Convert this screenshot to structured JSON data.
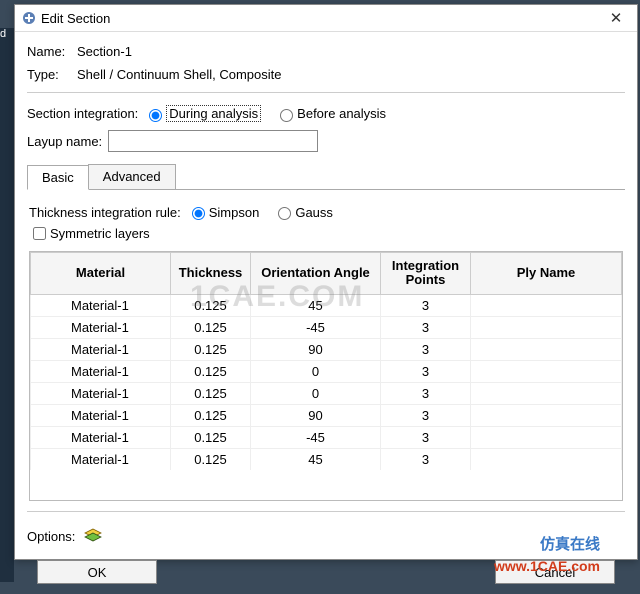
{
  "window": {
    "title": "Edit Section",
    "close": "✕"
  },
  "header": {
    "name_label": "Name:",
    "name_value": "Section-1",
    "type_label": "Type:",
    "type_value": "Shell / Continuum Shell, Composite"
  },
  "integration": {
    "label": "Section integration:",
    "during": "During analysis",
    "before": "Before analysis"
  },
  "layup": {
    "label": "Layup name:",
    "value": ""
  },
  "tabs": {
    "basic": "Basic",
    "advanced": "Advanced"
  },
  "thickness_rule": {
    "label": "Thickness integration rule:",
    "simpson": "Simpson",
    "gauss": "Gauss"
  },
  "symmetric_label": "Symmetric layers",
  "table": {
    "headers": {
      "material": "Material",
      "thickness": "Thickness",
      "orientation": "Orientation Angle",
      "points": "Integration\nPoints",
      "ply": "Ply Name"
    },
    "rows": [
      {
        "material": "Material-1",
        "thickness": "0.125",
        "orientation": "45",
        "points": "3",
        "ply": ""
      },
      {
        "material": "Material-1",
        "thickness": "0.125",
        "orientation": "-45",
        "points": "3",
        "ply": ""
      },
      {
        "material": "Material-1",
        "thickness": "0.125",
        "orientation": "90",
        "points": "3",
        "ply": ""
      },
      {
        "material": "Material-1",
        "thickness": "0.125",
        "orientation": "0",
        "points": "3",
        "ply": ""
      },
      {
        "material": "Material-1",
        "thickness": "0.125",
        "orientation": "0",
        "points": "3",
        "ply": ""
      },
      {
        "material": "Material-1",
        "thickness": "0.125",
        "orientation": "90",
        "points": "3",
        "ply": ""
      },
      {
        "material": "Material-1",
        "thickness": "0.125",
        "orientation": "-45",
        "points": "3",
        "ply": ""
      },
      {
        "material": "Material-1",
        "thickness": "0.125",
        "orientation": "45",
        "points": "3",
        "ply": ""
      }
    ]
  },
  "options_label": "Options:",
  "buttons": {
    "ok": "OK",
    "cancel": "Cancel"
  },
  "watermarks": {
    "w1": "1CAE.COM",
    "w2": "仿真在线",
    "w3": "www.1CAE.com"
  },
  "left_strip_label": "d"
}
